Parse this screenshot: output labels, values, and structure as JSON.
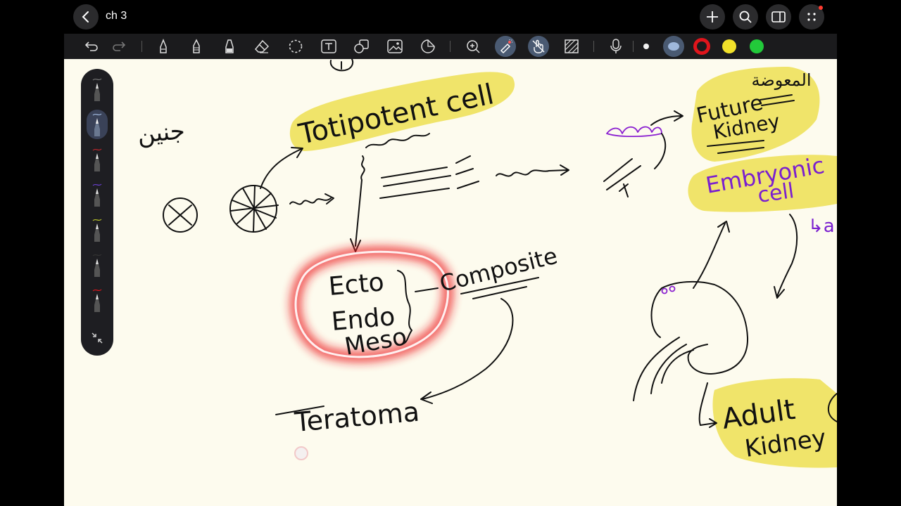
{
  "app": {
    "title": "ch 3"
  },
  "topbar": {
    "back_icon": "chevron-left-icon",
    "right_buttons": [
      "plus-icon",
      "search-icon",
      "sidebar-icon",
      "more-icon"
    ]
  },
  "toolbar": {
    "tools": [
      "undo-icon",
      "redo-icon",
      "pen-icon",
      "pencil-icon",
      "highlighter-icon",
      "eraser-icon",
      "lasso-icon",
      "text-icon",
      "shapes-icon",
      "image-icon",
      "sticker-icon",
      "zoom-icon",
      "laser-pointer-icon",
      "touch-draw-icon",
      "hide-toolbar-icon",
      "microphone-icon"
    ],
    "colors": {
      "white": "#ffffff",
      "blue_gray": "#7fa2d0",
      "red": "#e0151c",
      "yellow": "#f2e12a",
      "green": "#22c93a"
    }
  },
  "theme": {
    "canvas_bg": "#fdfbee",
    "highlight_yellow": "#f0e46a",
    "laser_red": "#ec1c24"
  },
  "notes": {
    "arabic_top_left": "جنين",
    "totipotent": "Totipotent cell",
    "ecto": "Ecto",
    "endo": "Endo",
    "meso": "Meso",
    "composite": "Composite",
    "teratoma": "Teratoma",
    "future_kidney_1": "Future",
    "future_kidney_2": "Kidney",
    "arabic_top_right": "المعوضة",
    "embryonic_1": "Embryonic",
    "embryonic_2": "cell",
    "adult_1": "Adult",
    "adult_2": "Kidney",
    "partial_arrow_text": "↳a"
  }
}
